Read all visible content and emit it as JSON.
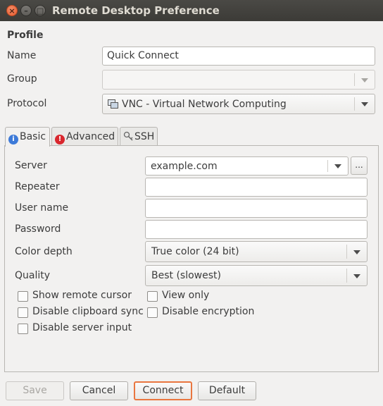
{
  "window": {
    "title": "Remote Desktop Preference",
    "close_glyph": "×",
    "minimize_glyph": "–",
    "maximize_glyph": "□"
  },
  "profile": {
    "section_label": "Profile",
    "name_label": "Name",
    "name_value": "Quick Connect",
    "group_label": "Group",
    "group_value": "",
    "protocol_label": "Protocol",
    "protocol_value": "VNC - Virtual Network Computing",
    "protocol_icon": "screen-icon"
  },
  "tabs": [
    {
      "label": "Basic",
      "icon": "info-icon",
      "active": true
    },
    {
      "label": "Advanced",
      "icon": "warning-icon",
      "active": false
    },
    {
      "label": "SSH",
      "icon": "key-icon",
      "active": false
    }
  ],
  "basic": {
    "server_label": "Server",
    "server_value": "example.com",
    "browse_label": "...",
    "repeater_label": "Repeater",
    "repeater_value": "",
    "username_label": "User name",
    "username_value": "",
    "password_label": "Password",
    "password_value": "",
    "colordepth_label": "Color depth",
    "colordepth_value": "True color (24 bit)",
    "quality_label": "Quality",
    "quality_value": "Best (slowest)",
    "checkboxes": {
      "show_remote_cursor": {
        "label": "Show remote cursor",
        "checked": false
      },
      "view_only": {
        "label": "View only",
        "checked": false
      },
      "disable_clipboard_sync": {
        "label": "Disable clipboard sync",
        "checked": false
      },
      "disable_encryption": {
        "label": "Disable encryption",
        "checked": false
      },
      "disable_server_input": {
        "label": "Disable server input",
        "checked": false
      }
    }
  },
  "buttons": {
    "save": "Save",
    "cancel": "Cancel",
    "connect": "Connect",
    "default": "Default"
  },
  "colors": {
    "titlebar": "#3c3b37",
    "window_bg": "#f2f1f0",
    "close_button": "#e65b2f",
    "default_button_border": "#e9763f",
    "info_icon": "#3d7ad8",
    "warning_icon": "#d9272e"
  }
}
